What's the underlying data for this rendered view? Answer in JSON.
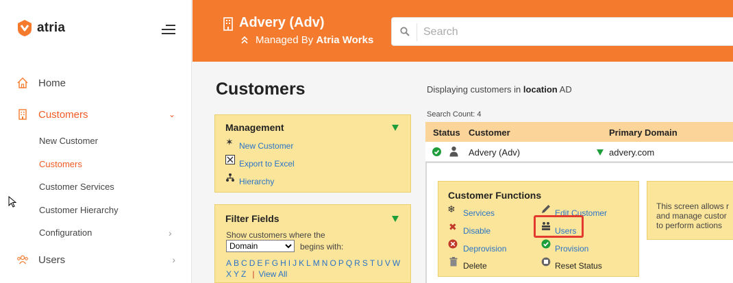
{
  "brand": {
    "name": "atria"
  },
  "sidebar": {
    "items": [
      {
        "label": "Home"
      },
      {
        "label": "Customers"
      },
      {
        "label": "Users"
      }
    ],
    "sub_items": [
      {
        "label": "New Customer"
      },
      {
        "label": "Customers"
      },
      {
        "label": "Customer Services"
      },
      {
        "label": "Customer Hierarchy"
      },
      {
        "label": "Configuration"
      }
    ]
  },
  "header": {
    "title": "Advery (Adv)",
    "managed_prefix": "Managed By",
    "managed_by": "Atria Works",
    "search_placeholder": "Search"
  },
  "page": {
    "title": "Customers",
    "display_prefix": "Displaying customers in",
    "display_bold": "location",
    "display_suffix": "AD"
  },
  "management": {
    "title": "Management",
    "links": [
      "New Customer",
      "Export to Excel",
      "Hierarchy"
    ]
  },
  "filter": {
    "title": "Filter Fields",
    "intro": "Show customers where the",
    "select_value": "Domain",
    "begins_with": "begins with:",
    "letters_line1": [
      "A",
      "B",
      "C",
      "D",
      "E",
      "F",
      "G",
      "H",
      "I",
      "J",
      "K",
      "L",
      "M",
      "N",
      "O",
      "P",
      "Q",
      "R",
      "S",
      "T",
      "U",
      "V",
      "W"
    ],
    "letters_line2": [
      "X",
      "Y",
      "Z"
    ],
    "view_all": "View All"
  },
  "table": {
    "search_count_label": "Search Count:",
    "search_count": "4",
    "headers": {
      "status": "Status",
      "customer": "Customer",
      "domain": "Primary Domain"
    },
    "rows": [
      {
        "customer": "Advery (Adv)",
        "domain": "advery.com"
      }
    ]
  },
  "functions": {
    "title": "Customer Functions",
    "left": [
      "Services",
      "Disable",
      "Deprovision",
      "Delete"
    ],
    "right": [
      "Edit Customer",
      "Users",
      "Provision",
      "Reset Status"
    ],
    "info_lines": [
      "This screen allows r",
      "and manage custor",
      "to perform actions"
    ]
  },
  "colors": {
    "accent": "#f47b2e",
    "active": "#f15a22",
    "panel": "#fbe59a",
    "link": "#2a73c6"
  }
}
